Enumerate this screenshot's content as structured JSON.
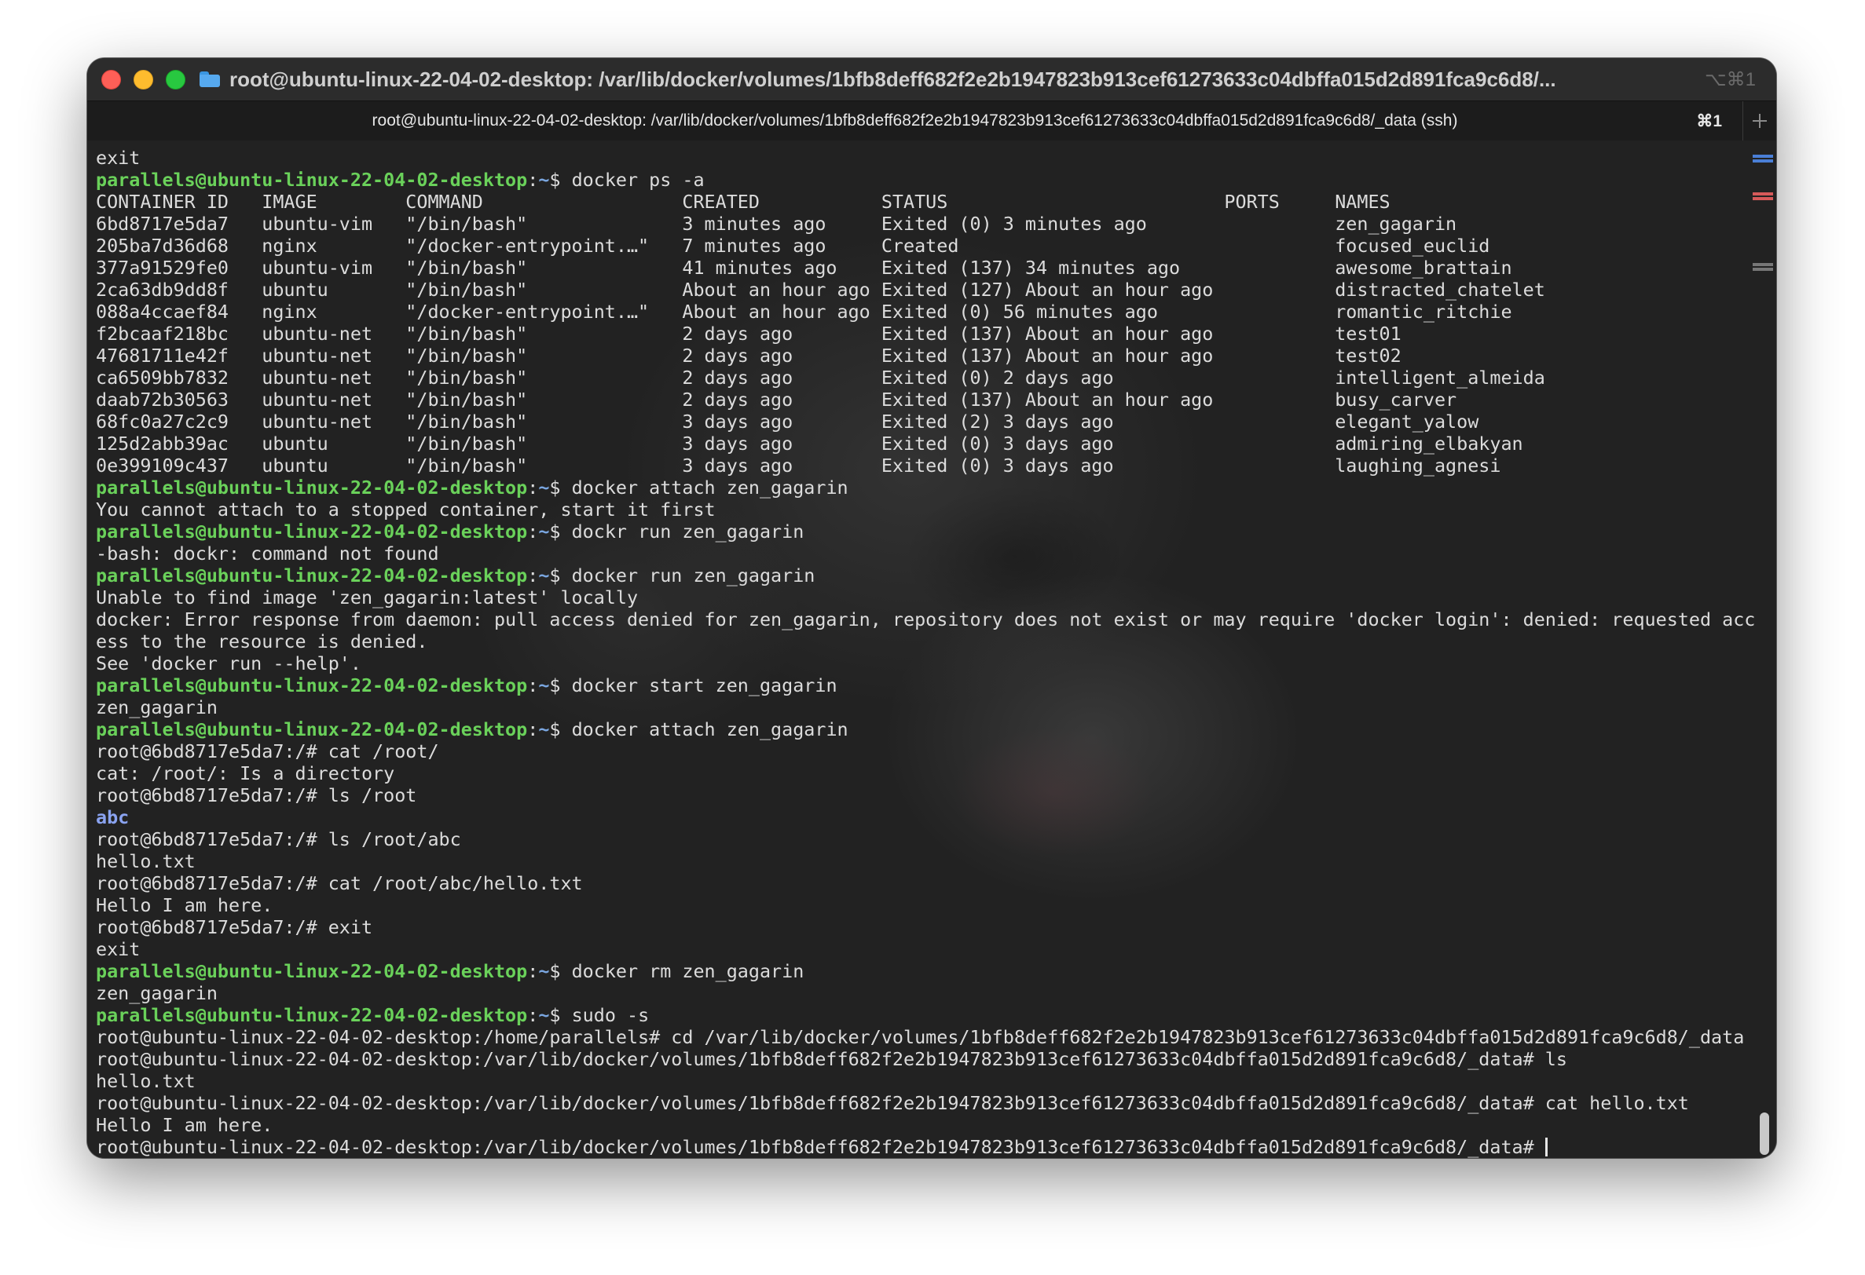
{
  "window": {
    "title": "root@ubuntu-linux-22-04-02-desktop: /var/lib/docker/volumes/1bfb8deff682f2e2b1947823b913cef61273633c04dbffa015d2d891fca9c6d8/...",
    "title_shortcut": "⌥⌘1",
    "icon": "folder-icon"
  },
  "tab": {
    "title": "root@ubuntu-linux-22-04-02-desktop: /var/lib/docker/volumes/1bfb8deff682f2e2b1947823b913cef61273633c04dbffa015d2d891fca9c6d8/_data (ssh)",
    "shortcut": "⌘1",
    "new_tab_icon": "plus-icon"
  },
  "colors": {
    "prompt_user": "#6ad15a",
    "prompt_path": "#7aa6e0",
    "directory": "#8aa3f0",
    "text": "#dcdcdc",
    "background": "#222222",
    "scroll_mark_blue": "#4a7fd6",
    "scroll_mark_red": "#d65a5a",
    "scroll_mark_gray": "#777777"
  },
  "terminal": {
    "lines": [
      {
        "type": "plain",
        "text": "exit"
      },
      {
        "type": "prompt",
        "user": "parallels@ubuntu-linux-22-04-02-desktop",
        "sep": ":",
        "path": "~",
        "cmd": "$ docker ps -a"
      },
      {
        "type": "plain",
        "text": "CONTAINER ID   IMAGE        COMMAND                  CREATED           STATUS                         PORTS     NAMES"
      },
      {
        "type": "plain",
        "text": "6bd8717e5da7   ubuntu-vim   \"/bin/bash\"              3 minutes ago     Exited (0) 3 minutes ago                 zen_gagarin"
      },
      {
        "type": "plain",
        "text": "205ba7d36d68   nginx        \"/docker-entrypoint.…\"   7 minutes ago     Created                                  focused_euclid"
      },
      {
        "type": "plain",
        "text": "377a91529fe0   ubuntu-vim   \"/bin/bash\"              41 minutes ago    Exited (137) 34 minutes ago              awesome_brattain"
      },
      {
        "type": "plain",
        "text": "2ca63db9dd8f   ubuntu       \"/bin/bash\"              About an hour ago Exited (127) About an hour ago           distracted_chatelet"
      },
      {
        "type": "plain",
        "text": "088a4ccaef84   nginx        \"/docker-entrypoint.…\"   About an hour ago Exited (0) 56 minutes ago                romantic_ritchie"
      },
      {
        "type": "plain",
        "text": "f2bcaaf218bc   ubuntu-net   \"/bin/bash\"              2 days ago        Exited (137) About an hour ago           test01"
      },
      {
        "type": "plain",
        "text": "47681711e42f   ubuntu-net   \"/bin/bash\"              2 days ago        Exited (137) About an hour ago           test02"
      },
      {
        "type": "plain",
        "text": "ca6509bb7832   ubuntu-net   \"/bin/bash\"              2 days ago        Exited (0) 2 days ago                    intelligent_almeida"
      },
      {
        "type": "plain",
        "text": "daab72b30563   ubuntu-net   \"/bin/bash\"              2 days ago        Exited (137) About an hour ago           busy_carver"
      },
      {
        "type": "plain",
        "text": "68fc0a27c2c9   ubuntu-net   \"/bin/bash\"              3 days ago        Exited (2) 3 days ago                    elegant_yalow"
      },
      {
        "type": "plain",
        "text": "125d2abb39ac   ubuntu       \"/bin/bash\"              3 days ago        Exited (0) 3 days ago                    admiring_elbakyan"
      },
      {
        "type": "plain",
        "text": "0e399109c437   ubuntu       \"/bin/bash\"              3 days ago        Exited (0) 3 days ago                    laughing_agnesi"
      },
      {
        "type": "prompt",
        "user": "parallels@ubuntu-linux-22-04-02-desktop",
        "sep": ":",
        "path": "~",
        "cmd": "$ docker attach zen_gagarin"
      },
      {
        "type": "plain",
        "text": "You cannot attach to a stopped container, start it first"
      },
      {
        "type": "prompt",
        "user": "parallels@ubuntu-linux-22-04-02-desktop",
        "sep": ":",
        "path": "~",
        "cmd": "$ dockr run zen_gagarin"
      },
      {
        "type": "plain",
        "text": "-bash: dockr: command not found"
      },
      {
        "type": "prompt",
        "user": "parallels@ubuntu-linux-22-04-02-desktop",
        "sep": ":",
        "path": "~",
        "cmd": "$ docker run zen_gagarin"
      },
      {
        "type": "plain",
        "text": "Unable to find image 'zen_gagarin:latest' locally"
      },
      {
        "type": "plain",
        "text": "docker: Error response from daemon: pull access denied for zen_gagarin, repository does not exist or may require 'docker login': denied: requested acc"
      },
      {
        "type": "plain",
        "text": "ess to the resource is denied."
      },
      {
        "type": "plain",
        "text": "See 'docker run --help'."
      },
      {
        "type": "prompt",
        "user": "parallels@ubuntu-linux-22-04-02-desktop",
        "sep": ":",
        "path": "~",
        "cmd": "$ docker start zen_gagarin"
      },
      {
        "type": "plain",
        "text": "zen_gagarin"
      },
      {
        "type": "prompt",
        "user": "parallels@ubuntu-linux-22-04-02-desktop",
        "sep": ":",
        "path": "~",
        "cmd": "$ docker attach zen_gagarin"
      },
      {
        "type": "plain",
        "text": "root@6bd8717e5da7:/# cat /root/"
      },
      {
        "type": "plain",
        "text": "cat: /root/: Is a directory"
      },
      {
        "type": "plain",
        "text": "root@6bd8717e5da7:/# ls /root"
      },
      {
        "type": "dir",
        "text": "abc"
      },
      {
        "type": "plain",
        "text": "root@6bd8717e5da7:/# ls /root/abc"
      },
      {
        "type": "plain",
        "text": "hello.txt"
      },
      {
        "type": "plain",
        "text": "root@6bd8717e5da7:/# cat /root/abc/hello.txt"
      },
      {
        "type": "plain",
        "text": "Hello I am here."
      },
      {
        "type": "plain",
        "text": "root@6bd8717e5da7:/# exit"
      },
      {
        "type": "plain",
        "text": "exit"
      },
      {
        "type": "prompt",
        "user": "parallels@ubuntu-linux-22-04-02-desktop",
        "sep": ":",
        "path": "~",
        "cmd": "$ docker rm zen_gagarin"
      },
      {
        "type": "plain",
        "text": "zen_gagarin"
      },
      {
        "type": "prompt",
        "user": "parallels@ubuntu-linux-22-04-02-desktop",
        "sep": ":",
        "path": "~",
        "cmd": "$ sudo -s"
      },
      {
        "type": "plain",
        "text": "root@ubuntu-linux-22-04-02-desktop:/home/parallels# cd /var/lib/docker/volumes/1bfb8deff682f2e2b1947823b913cef61273633c04dbffa015d2d891fca9c6d8/_data"
      },
      {
        "type": "plain",
        "text": "root@ubuntu-linux-22-04-02-desktop:/var/lib/docker/volumes/1bfb8deff682f2e2b1947823b913cef61273633c04dbffa015d2d891fca9c6d8/_data# ls"
      },
      {
        "type": "plain",
        "text": "hello.txt"
      },
      {
        "type": "plain",
        "text": "root@ubuntu-linux-22-04-02-desktop:/var/lib/docker/volumes/1bfb8deff682f2e2b1947823b913cef61273633c04dbffa015d2d891fca9c6d8/_data# cat hello.txt"
      },
      {
        "type": "plain",
        "text": "Hello I am here."
      },
      {
        "type": "cursor",
        "text": "root@ubuntu-linux-22-04-02-desktop:/var/lib/docker/volumes/1bfb8deff682f2e2b1947823b913cef61273633c04dbffa015d2d891fca9c6d8/_data# "
      }
    ]
  }
}
